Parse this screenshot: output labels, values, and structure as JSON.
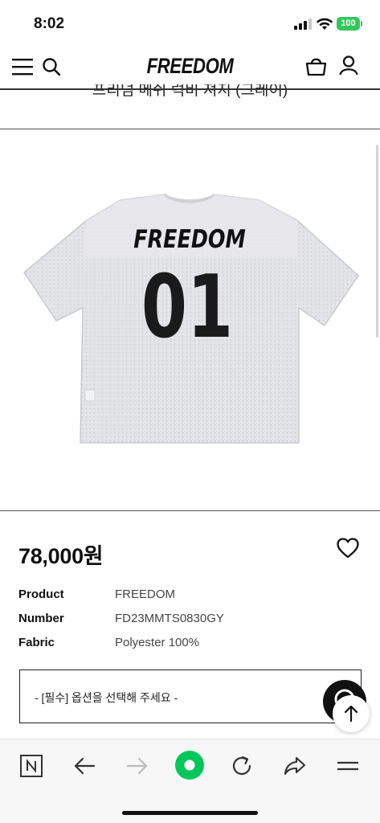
{
  "status": {
    "time": "8:02",
    "battery": "100"
  },
  "header": {
    "logo": "FREEDOM"
  },
  "product": {
    "title": "프리덤 메쉬 럭비 져지 (그레이)",
    "image": {
      "front_text": "FREEDOM",
      "number": "01"
    },
    "price": "78,000원",
    "specs": [
      {
        "label": "Product",
        "value": "FREEDOM"
      },
      {
        "label": "Number",
        "value": "FD23MMTS0830GY"
      },
      {
        "label": "Fabric",
        "value": "Polyester 100%"
      }
    ],
    "option_placeholder": "- [필수] 옵션을 선택해 주세요 -"
  },
  "icons": {
    "menu": "menu-icon",
    "search": "search-icon",
    "cart": "bag-icon",
    "user": "user-icon",
    "wish": "heart-icon",
    "chat": "chat-icon",
    "scroll_top": "arrow-up-icon"
  },
  "toolbar": [
    "naver-home-icon",
    "back-icon",
    "forward-icon",
    "green-dot-icon",
    "refresh-icon",
    "share-icon",
    "more-menu-icon"
  ],
  "colors": {
    "accent_green": "#03c75a",
    "battery": "#34c759"
  }
}
